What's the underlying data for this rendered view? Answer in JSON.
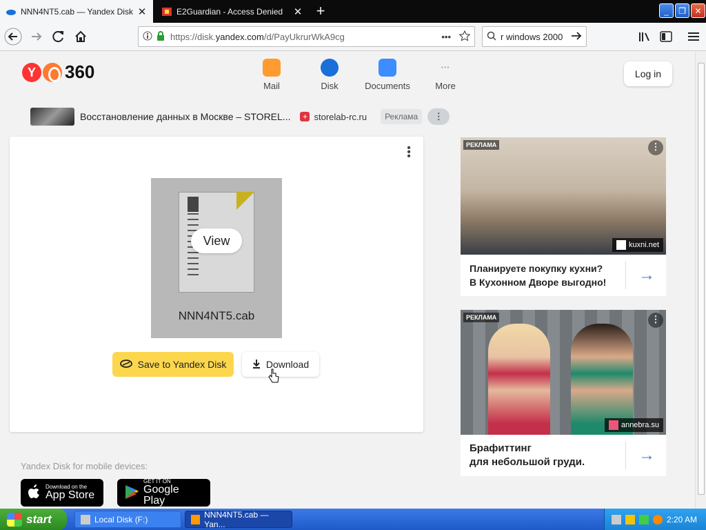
{
  "browser": {
    "tabs": [
      {
        "title": "NNN4NT5.cab — Yandex Disk",
        "active": true
      },
      {
        "title": "E2Guardian - Access Denied",
        "active": false
      }
    ],
    "url_prefix": "https://disk.",
    "url_domain": "yandex.com",
    "url_rest": "/d/PayUkrurWkA9cg",
    "search_text": "r windows 2000"
  },
  "header": {
    "logo_number": "360",
    "nav": [
      {
        "label": "Mail",
        "color": "#ff9b2f"
      },
      {
        "label": "Disk",
        "color": "#1a6fd9"
      },
      {
        "label": "Documents",
        "color": "#3c8dff"
      },
      {
        "label": "More",
        "color": "#9aa0a6"
      }
    ],
    "login_label": "Log in"
  },
  "ad_line": {
    "text": "Восстановление данных в Москве – STOREL...",
    "domain": "storelab-rc.ru",
    "tag": "Реклама",
    "dots": "⋮"
  },
  "file": {
    "view_label": "View",
    "name": "NNN4NT5.cab",
    "save_label": "Save to Yandex Disk",
    "download_label": "Download"
  },
  "mobile": {
    "caption": "Yandex Disk for mobile devices:",
    "appstore_small": "Download on the",
    "appstore_big": "App Store",
    "gplay_small": "GET IT ON",
    "gplay_big": "Google Play"
  },
  "ads": [
    {
      "label": "РЕКЛАМА",
      "source": "kuxni.net",
      "line1": "Планируете покупку кухни?",
      "line2": "В Кухонном Дворе выгодно!"
    },
    {
      "label": "РЕКЛАМА",
      "source": "annebra.su",
      "line1": "Брафиттинг",
      "line2": "для небольшой груди."
    }
  ],
  "taskbar": {
    "start_label": "start",
    "tasks": [
      "Local Disk (F:)",
      "NNN4NT5.cab — Yan..."
    ],
    "clock": "2:20 AM"
  }
}
